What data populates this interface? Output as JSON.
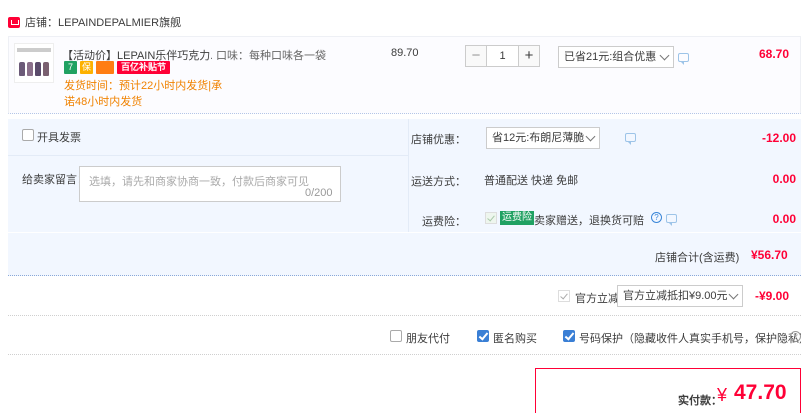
{
  "shop": {
    "label": "店铺：LEPAINDEPALMIER旗舰"
  },
  "item": {
    "title": "【活动价】LEPAIN乐伴巧克力...",
    "flavor": "口味：每种口味各一袋",
    "badges": {
      "b1": "7",
      "b2": "保",
      "b3": "",
      "b4": "百亿补贴节"
    },
    "shipping_line1": "发货时间：预计22小时内发货|承",
    "shipping_line2": "诺48小时内发货",
    "unit_price": "89.70",
    "quantity": "1",
    "qty_minus": "−",
    "qty_plus": "+",
    "promo": "已省21元:组合优惠",
    "subtotal": "68.70"
  },
  "extras": {
    "invoice_label": "开具发票",
    "message_label": "给卖家留言：",
    "message_placeholder": "选填，请先和商家协商一致，付款后商家可见",
    "message_count": "0/200",
    "shop_discount_label": "店铺优惠：",
    "shop_discount_select": "省12元:布朗尼薄脆",
    "shop_discount_value": "-12.00",
    "delivery_label": "运送方式：",
    "delivery_text": "普通配送 快递 免邮",
    "delivery_value": "0.00",
    "insurance_label": "运费险：",
    "insurance_tag": "运费险",
    "insurance_text": "卖家赠送，退换货可赔",
    "insurance_value": "0.00"
  },
  "shop_total": {
    "label": "店铺合计(含运费)",
    "value": "¥56.70"
  },
  "tmall_discount": {
    "label": "官方立减",
    "select": "官方立减抵扣¥9.00元",
    "value": "-¥9.00"
  },
  "options": {
    "friend_pay": "朋友代付",
    "anonymous": "匿名购买",
    "privacy": "号码保护（隐藏收件人真实手机号，保护隐私）"
  },
  "payment": {
    "label": "实付款：",
    "currency": "¥",
    "value": "47.70"
  },
  "colors": {
    "accent_red": "#ff0036",
    "orange": "#f08200",
    "panel_bg": "#f2f7ff",
    "checkbox_blue": "#3a7fd5"
  },
  "icons": {
    "shop": "shop-icon",
    "chat": "chat-icon",
    "help": "help-icon",
    "chevron": "chevron-down-icon",
    "checkbox": "checkbox-icon"
  }
}
